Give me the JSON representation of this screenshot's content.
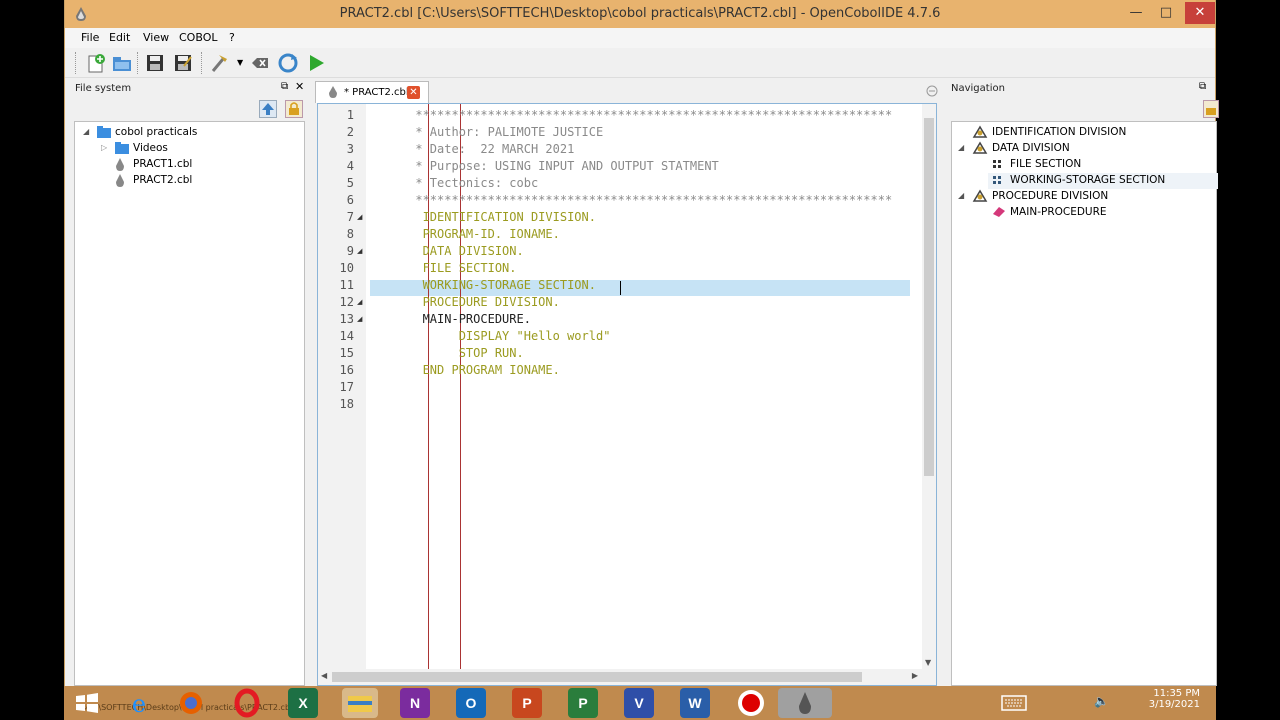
{
  "window": {
    "title": "PRACT2.cbl [C:\\Users\\SOFTTECH\\Desktop\\cobol practicals\\PRACT2.cbl] - OpenCobolIDE 4.7.6",
    "minimize": "—",
    "maximize": "□",
    "close": "✕"
  },
  "menu": [
    "File",
    "Edit",
    "View",
    "COBOL",
    "?"
  ],
  "toolbar_icons": [
    "new-file-icon",
    "open-file-icon",
    "save-icon",
    "save-as-icon",
    "compile-icon",
    "clean-icon",
    "rebuild-icon",
    "run-icon"
  ],
  "file_system": {
    "title": "File system",
    "tree": [
      {
        "label": "cobol practicals",
        "icon": "folder-icon",
        "expanded": true
      },
      {
        "label": "Videos",
        "icon": "folder-icon",
        "expanded": false
      },
      {
        "label": "PRACT1.cbl",
        "icon": "cobol-file-icon"
      },
      {
        "label": "PRACT2.cbl",
        "icon": "cobol-file-icon"
      }
    ]
  },
  "editor": {
    "tab_label": "* PRACT2.cbl",
    "current_line": 11,
    "lines": [
      {
        "n": "1",
        "text": "      ******************************************************************",
        "cls": "c-comment"
      },
      {
        "n": "2",
        "text": "      * Author: PALIMOTE JUSTICE",
        "cls": "c-comment"
      },
      {
        "n": "3",
        "text": "      * Date:  22 MARCH 2021",
        "cls": "c-comment"
      },
      {
        "n": "4",
        "text": "      * Purpose: USING INPUT AND OUTPUT STATMENT",
        "cls": "c-comment"
      },
      {
        "n": "5",
        "text": "      * Tectonics: cobc",
        "cls": "c-comment"
      },
      {
        "n": "6",
        "text": "      ******************************************************************",
        "cls": "c-comment"
      },
      {
        "n": "7",
        "text": "       IDENTIFICATION DIVISION.",
        "cls": "c-kw"
      },
      {
        "n": "8",
        "text": "       PROGRAM-ID. IONAME.",
        "cls": "c-kw"
      },
      {
        "n": "9",
        "text": "       DATA DIVISION.",
        "cls": "c-kw"
      },
      {
        "n": "10",
        "text": "       FILE SECTION.",
        "cls": "c-kw"
      },
      {
        "n": "11",
        "text": "       WORKING-STORAGE SECTION.",
        "cls": "c-kw"
      },
      {
        "n": "12",
        "text": "       PROCEDURE DIVISION.",
        "cls": "c-kw"
      },
      {
        "n": "13",
        "text": "       MAIN-PROCEDURE.",
        "cls": "c-plain"
      },
      {
        "n": "14",
        "text": "            DISPLAY \"Hello world\"",
        "cls": "c-kw"
      },
      {
        "n": "15",
        "text": "            STOP RUN.",
        "cls": "c-kw"
      },
      {
        "n": "16",
        "text": "       END PROGRAM IONAME.",
        "cls": "c-kw"
      },
      {
        "n": "17",
        "text": "",
        "cls": "c-plain"
      },
      {
        "n": "18",
        "text": "",
        "cls": "c-plain"
      }
    ],
    "fold_lines": [
      "7",
      "9",
      "12",
      "13"
    ]
  },
  "navigation": {
    "title": "Navigation",
    "tree": [
      {
        "label": "IDENTIFICATION DIVISION",
        "icon": "division-icon"
      },
      {
        "label": "DATA DIVISION",
        "icon": "division-icon"
      },
      {
        "label": "FILE SECTION",
        "icon": "section-icon"
      },
      {
        "label": "WORKING-STORAGE SECTION",
        "icon": "section-icon",
        "selected": true
      },
      {
        "label": "PROCEDURE DIVISION",
        "icon": "division-icon"
      },
      {
        "label": "MAIN-PROCEDURE",
        "icon": "paragraph-icon"
      }
    ]
  },
  "taskbar": {
    "path_text": "Users\\SOFTTECH\\Desktop\\cobol practicals\\PRACT2.cbl",
    "time": "11:35 PM",
    "date": "3/19/2021",
    "apps": [
      "windows-start-icon",
      "internet-explorer-icon",
      "firefox-icon",
      "opera-icon",
      "excel-icon",
      "file-explorer-icon",
      "onenote-icon",
      "outlook-icon",
      "powerpoint-icon",
      "project-icon",
      "visio-icon",
      "word-icon",
      "record-icon",
      "opencobolide-icon"
    ]
  },
  "colors": {
    "titlebar": "#e8b36e",
    "taskbar": "#c08a4e",
    "highlight": "#c6e3f5",
    "close": "#c7403a"
  }
}
